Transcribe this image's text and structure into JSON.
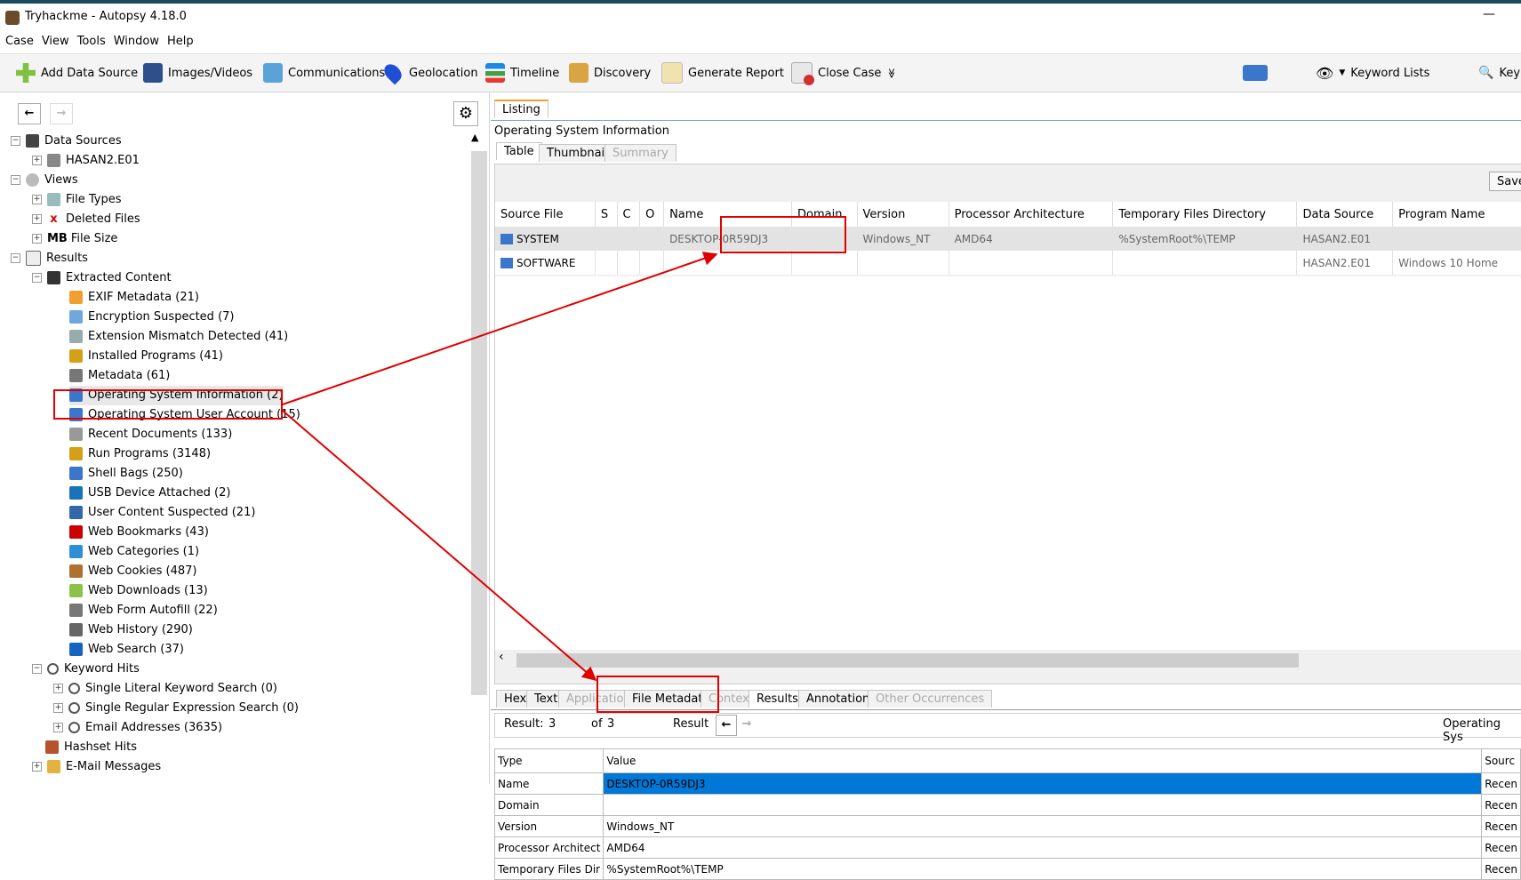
{
  "window": {
    "title": "Tryhackme - Autopsy 4.18.0",
    "minimize": "—"
  },
  "menu": [
    "Case",
    "View",
    "Tools",
    "Window",
    "Help"
  ],
  "toolbar": {
    "buttons": [
      "Add Data Source",
      "Images/Videos",
      "Communications",
      "Geolocation",
      "Timeline",
      "Discovery",
      "Generate Report",
      "Close Case"
    ],
    "more": "≫",
    "keyword_lists": "Keyword Lists",
    "keyword_search": "Key"
  },
  "tree": {
    "data_sources": "Data Sources",
    "hasan": "HASAN2.E01",
    "views": "Views",
    "file_types": "File Types",
    "deleted_files": "Deleted Files",
    "mb": "MB",
    "file_size": "File Size",
    "results": "Results",
    "extracted_content": "Extracted Content",
    "items": [
      "EXIF Metadata (21)",
      "Encryption Suspected (7)",
      "Extension Mismatch Detected (41)",
      "Installed Programs (41)",
      "Metadata (61)",
      "Operating System Information (2)",
      "Operating System User Account (15)",
      "Recent Documents (133)",
      "Run Programs (3148)",
      "Shell Bags (250)",
      "USB Device Attached (2)",
      "User Content Suspected (21)",
      "Web Bookmarks (43)",
      "Web Categories (1)",
      "Web Cookies (487)",
      "Web Downloads (13)",
      "Web Form Autofill (22)",
      "Web History (290)",
      "Web Search (37)"
    ],
    "keyword_hits": "Keyword Hits",
    "kw_items": [
      "Single Literal Keyword Search (0)",
      "Single Regular Expression Search (0)",
      "Email Addresses (3635)"
    ],
    "hashset_hits": "Hashset Hits",
    "email_messages": "E-Mail Messages"
  },
  "listing": {
    "tab": "Listing",
    "title": "Operating System Information",
    "subtabs": [
      "Table",
      "Thumbnail",
      "Summary"
    ],
    "save": "Save",
    "columns": [
      "Source File",
      "S",
      "C",
      "O",
      "Name",
      "Domain",
      "Version",
      "Processor Architecture",
      "Temporary Files Directory",
      "Data Source",
      "Program Name"
    ],
    "rows": [
      [
        "SYSTEM",
        "",
        "",
        "",
        "DESKTOP-0R59DJ3",
        "",
        "Windows_NT",
        "AMD64",
        "%SystemRoot%\\TEMP",
        "HASAN2.E01",
        ""
      ],
      [
        "SOFTWARE",
        "",
        "",
        "",
        "",
        "",
        "",
        "",
        "",
        "HASAN2.E01",
        "Windows 10 Home"
      ]
    ]
  },
  "content": {
    "tabs": [
      "Hex",
      "Text",
      "Application",
      "File Metadata",
      "Context",
      "Results",
      "Annotations",
      "Other Occurrences"
    ],
    "result_label": "Result:",
    "result_num": "3",
    "of_label": "of",
    "of_num": "3",
    "result2": "Result",
    "os_label": "Operating Sys",
    "columns": [
      "Type",
      "Value",
      "Sourc"
    ],
    "rows": [
      [
        "Name",
        "DESKTOP-0R59DJ3",
        "Recen"
      ],
      [
        "Domain",
        "",
        "Recen"
      ],
      [
        "Version",
        "Windows_NT",
        "Recen"
      ],
      [
        "Processor Architect",
        "AMD64",
        "Recen"
      ],
      [
        "Temporary Files Dir",
        "%SystemRoot%\\TEMP",
        "Recen"
      ]
    ]
  },
  "colors": {
    "highlight": "#0078d7",
    "annotation": "#e00000",
    "titlebar_accent": "#1b4a5e"
  }
}
